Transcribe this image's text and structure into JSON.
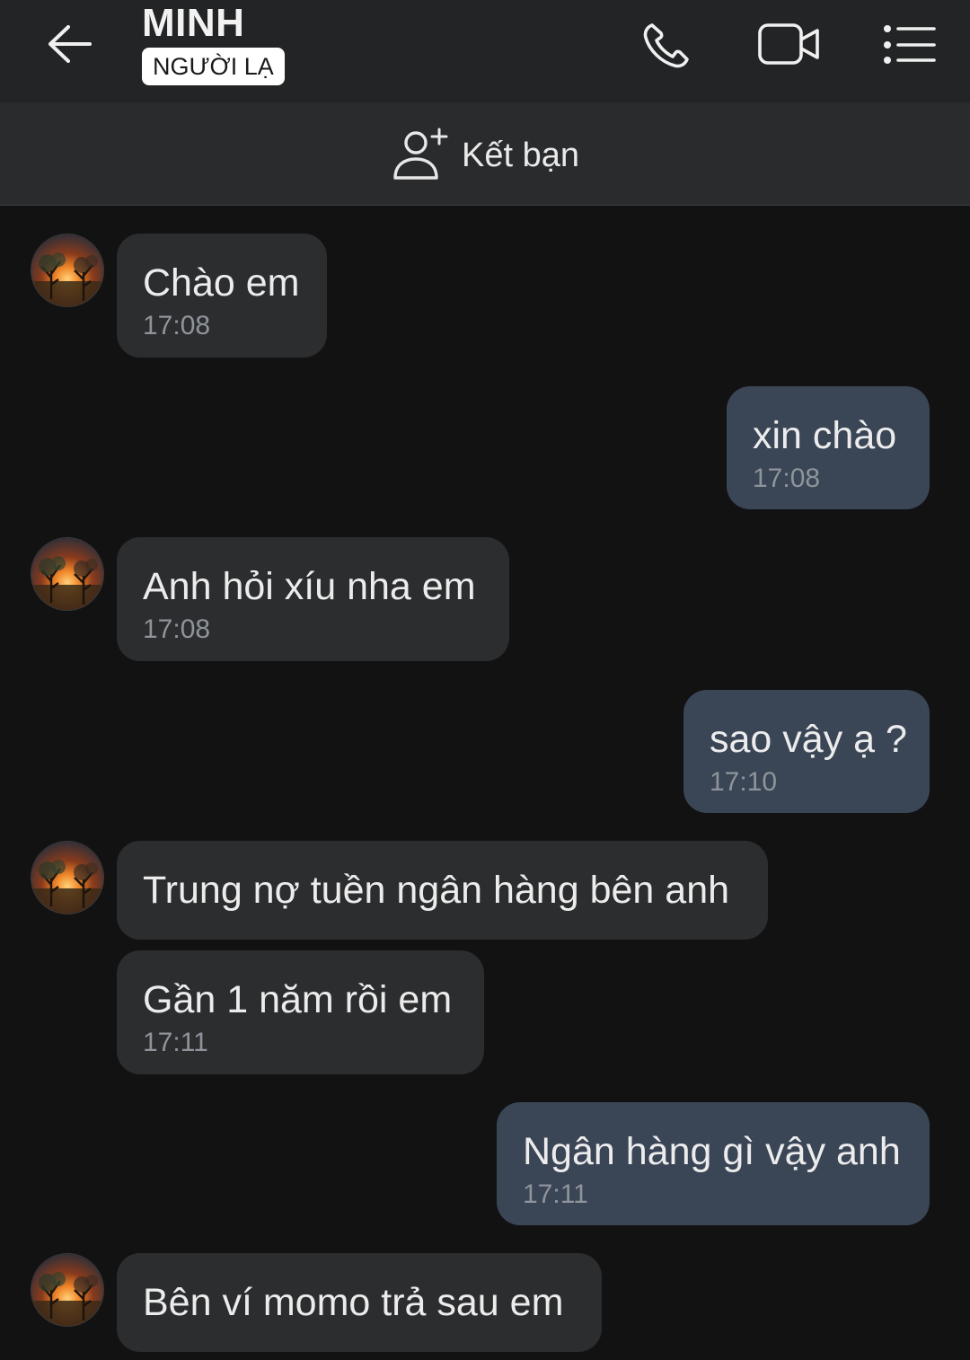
{
  "header": {
    "contact_name": "MINH",
    "badge": "NGƯỜI LẠ",
    "icons": [
      "back-arrow-icon",
      "phone-icon",
      "video-camera-icon",
      "list-menu-icon"
    ]
  },
  "add_friend": {
    "label": "Kết bạn",
    "icon": "add-user-icon"
  },
  "messages": [
    {
      "side": "in",
      "text": "Chào em",
      "time": "17:08"
    },
    {
      "side": "out",
      "text": "xin chào",
      "time": "17:08"
    },
    {
      "side": "in",
      "text": "Anh hỏi xíu nha em",
      "time": "17:08"
    },
    {
      "side": "out",
      "text": "sao vậy ạ ?",
      "time": "17:10"
    },
    {
      "side": "in",
      "text": "Trung nợ tuền ngân hàng bên anh",
      "time": ""
    },
    {
      "side": "in",
      "text": "Gần 1 năm rồi em",
      "time": "17:11"
    },
    {
      "side": "out",
      "text": "Ngân hàng gì vậy anh",
      "time": "17:11"
    },
    {
      "side": "in",
      "text": "Bên ví momo trả sau em",
      "time": ""
    }
  ],
  "colors": {
    "background": "#121213",
    "header": "#232425",
    "incoming_bubble": "#2c2d2f",
    "outgoing_bubble": "#3a4556",
    "timestamp": "#8f949b"
  }
}
